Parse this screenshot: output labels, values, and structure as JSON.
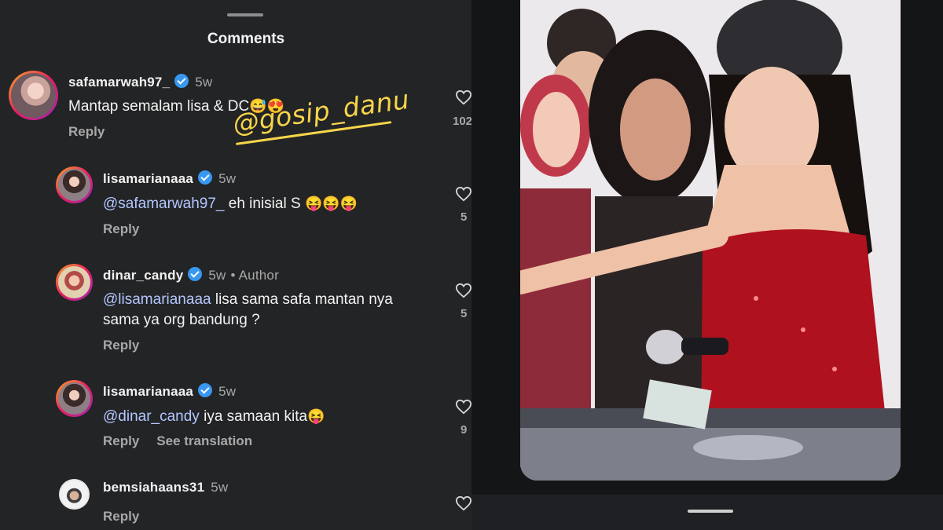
{
  "header": {
    "title": "Comments"
  },
  "watermark": {
    "text": "@gosip_danu"
  },
  "comments": [
    {
      "username": "safamarwah97_",
      "time": "5w",
      "author_tag": "",
      "parts": [
        {
          "type": "text",
          "value": "Mantap semalam lisa & DC"
        },
        {
          "type": "emoji",
          "value": "😅😍"
        }
      ],
      "reply": "Reply",
      "likes": "102"
    },
    {
      "username": "lisamarianaaa",
      "time": "5w",
      "author_tag": "",
      "mention": "@safamarwah97_",
      "text": " eh inisial S ",
      "emoji": "😝😝😝",
      "reply": "Reply",
      "likes": "5"
    },
    {
      "username": "dinar_candy",
      "time": "5w",
      "author_tag": "• Author",
      "mention": "@lisamarianaaa",
      "text": " lisa sama safa mantan nya",
      "text2": "sama ya org bandung ?",
      "reply": "Reply",
      "likes": "5"
    },
    {
      "username": "lisamarianaaa",
      "time": "5w",
      "author_tag": "",
      "mention": "@dinar_candy",
      "text": " iya samaan kita",
      "emoji": "😝",
      "reply": "Reply",
      "translate": "See translation",
      "likes": "9"
    },
    {
      "username": "bemsiahaans31",
      "time": "5w",
      "author_tag": "",
      "reply": "Reply"
    }
  ],
  "colors": {
    "panel_bg": "#232426",
    "mention": "#b3c6ff",
    "verified": "#3897f0",
    "watermark": "#f7d54a"
  },
  "icons": [
    "heart-icon",
    "verified-badge-icon"
  ]
}
